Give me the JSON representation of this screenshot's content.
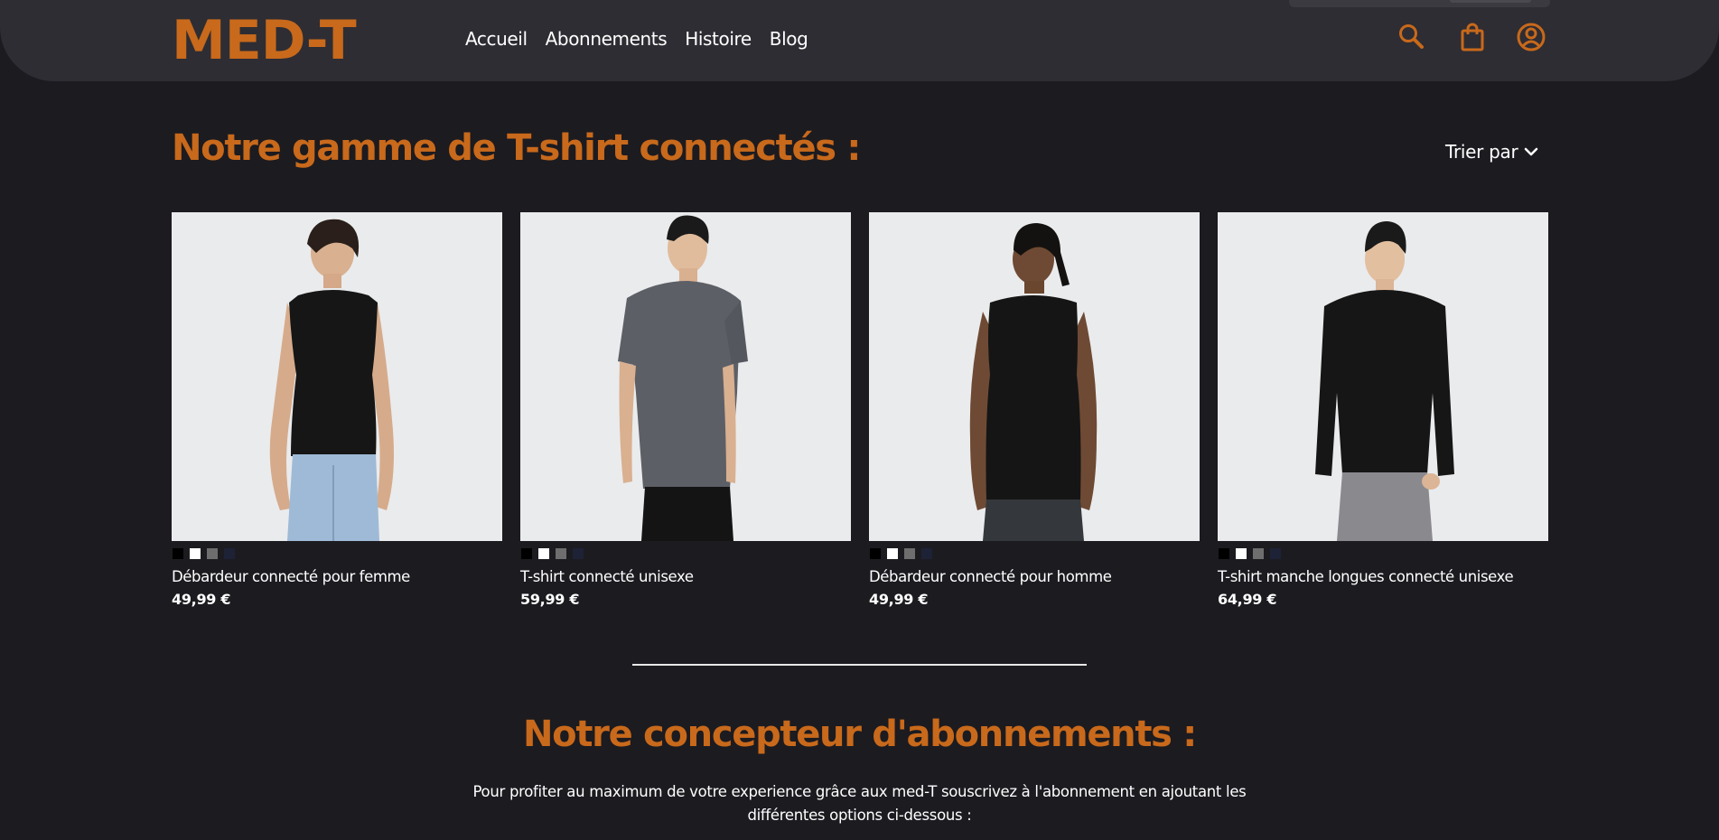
{
  "header": {
    "logo": "MED-T",
    "nav": [
      "Accueil",
      "Abonnements",
      "Histoire",
      "Blog"
    ],
    "icons": [
      "search-icon",
      "shopping-bag-icon",
      "user-account-icon"
    ]
  },
  "colors": {
    "accent": "#c8691b",
    "background": "#1c1b20",
    "header": "#2e2d33"
  },
  "catalog": {
    "title": "Notre gamme de T-shirt connectés :",
    "sort_label": "Trier par",
    "products": [
      {
        "name": "Débardeur connecté pour femme",
        "price": "49,99 €",
        "image": "woman-black-tank-top"
      },
      {
        "name": "T-shirt connecté unisexe",
        "price": "59,99 €",
        "image": "man-grey-tshirt"
      },
      {
        "name": "Débardeur connecté pour homme",
        "price": "49,99 €",
        "image": "man-black-tank-top"
      },
      {
        "name": "T-shirt manche longues connecté unisexe",
        "price": "64,99 €",
        "image": "man-black-long-sleeve"
      }
    ],
    "swatch_colors": [
      "#000000",
      "#ffffff",
      "#6e6e6e",
      "#1e2236"
    ]
  },
  "subscription": {
    "title": "Notre concepteur d'abonnements :",
    "intro_line1": "Pour profiter au maximum de votre experience grâce aux med-T souscrivez à l'abonnement en ajoutant les",
    "intro_line2": "différentes options ci-dessous :"
  }
}
